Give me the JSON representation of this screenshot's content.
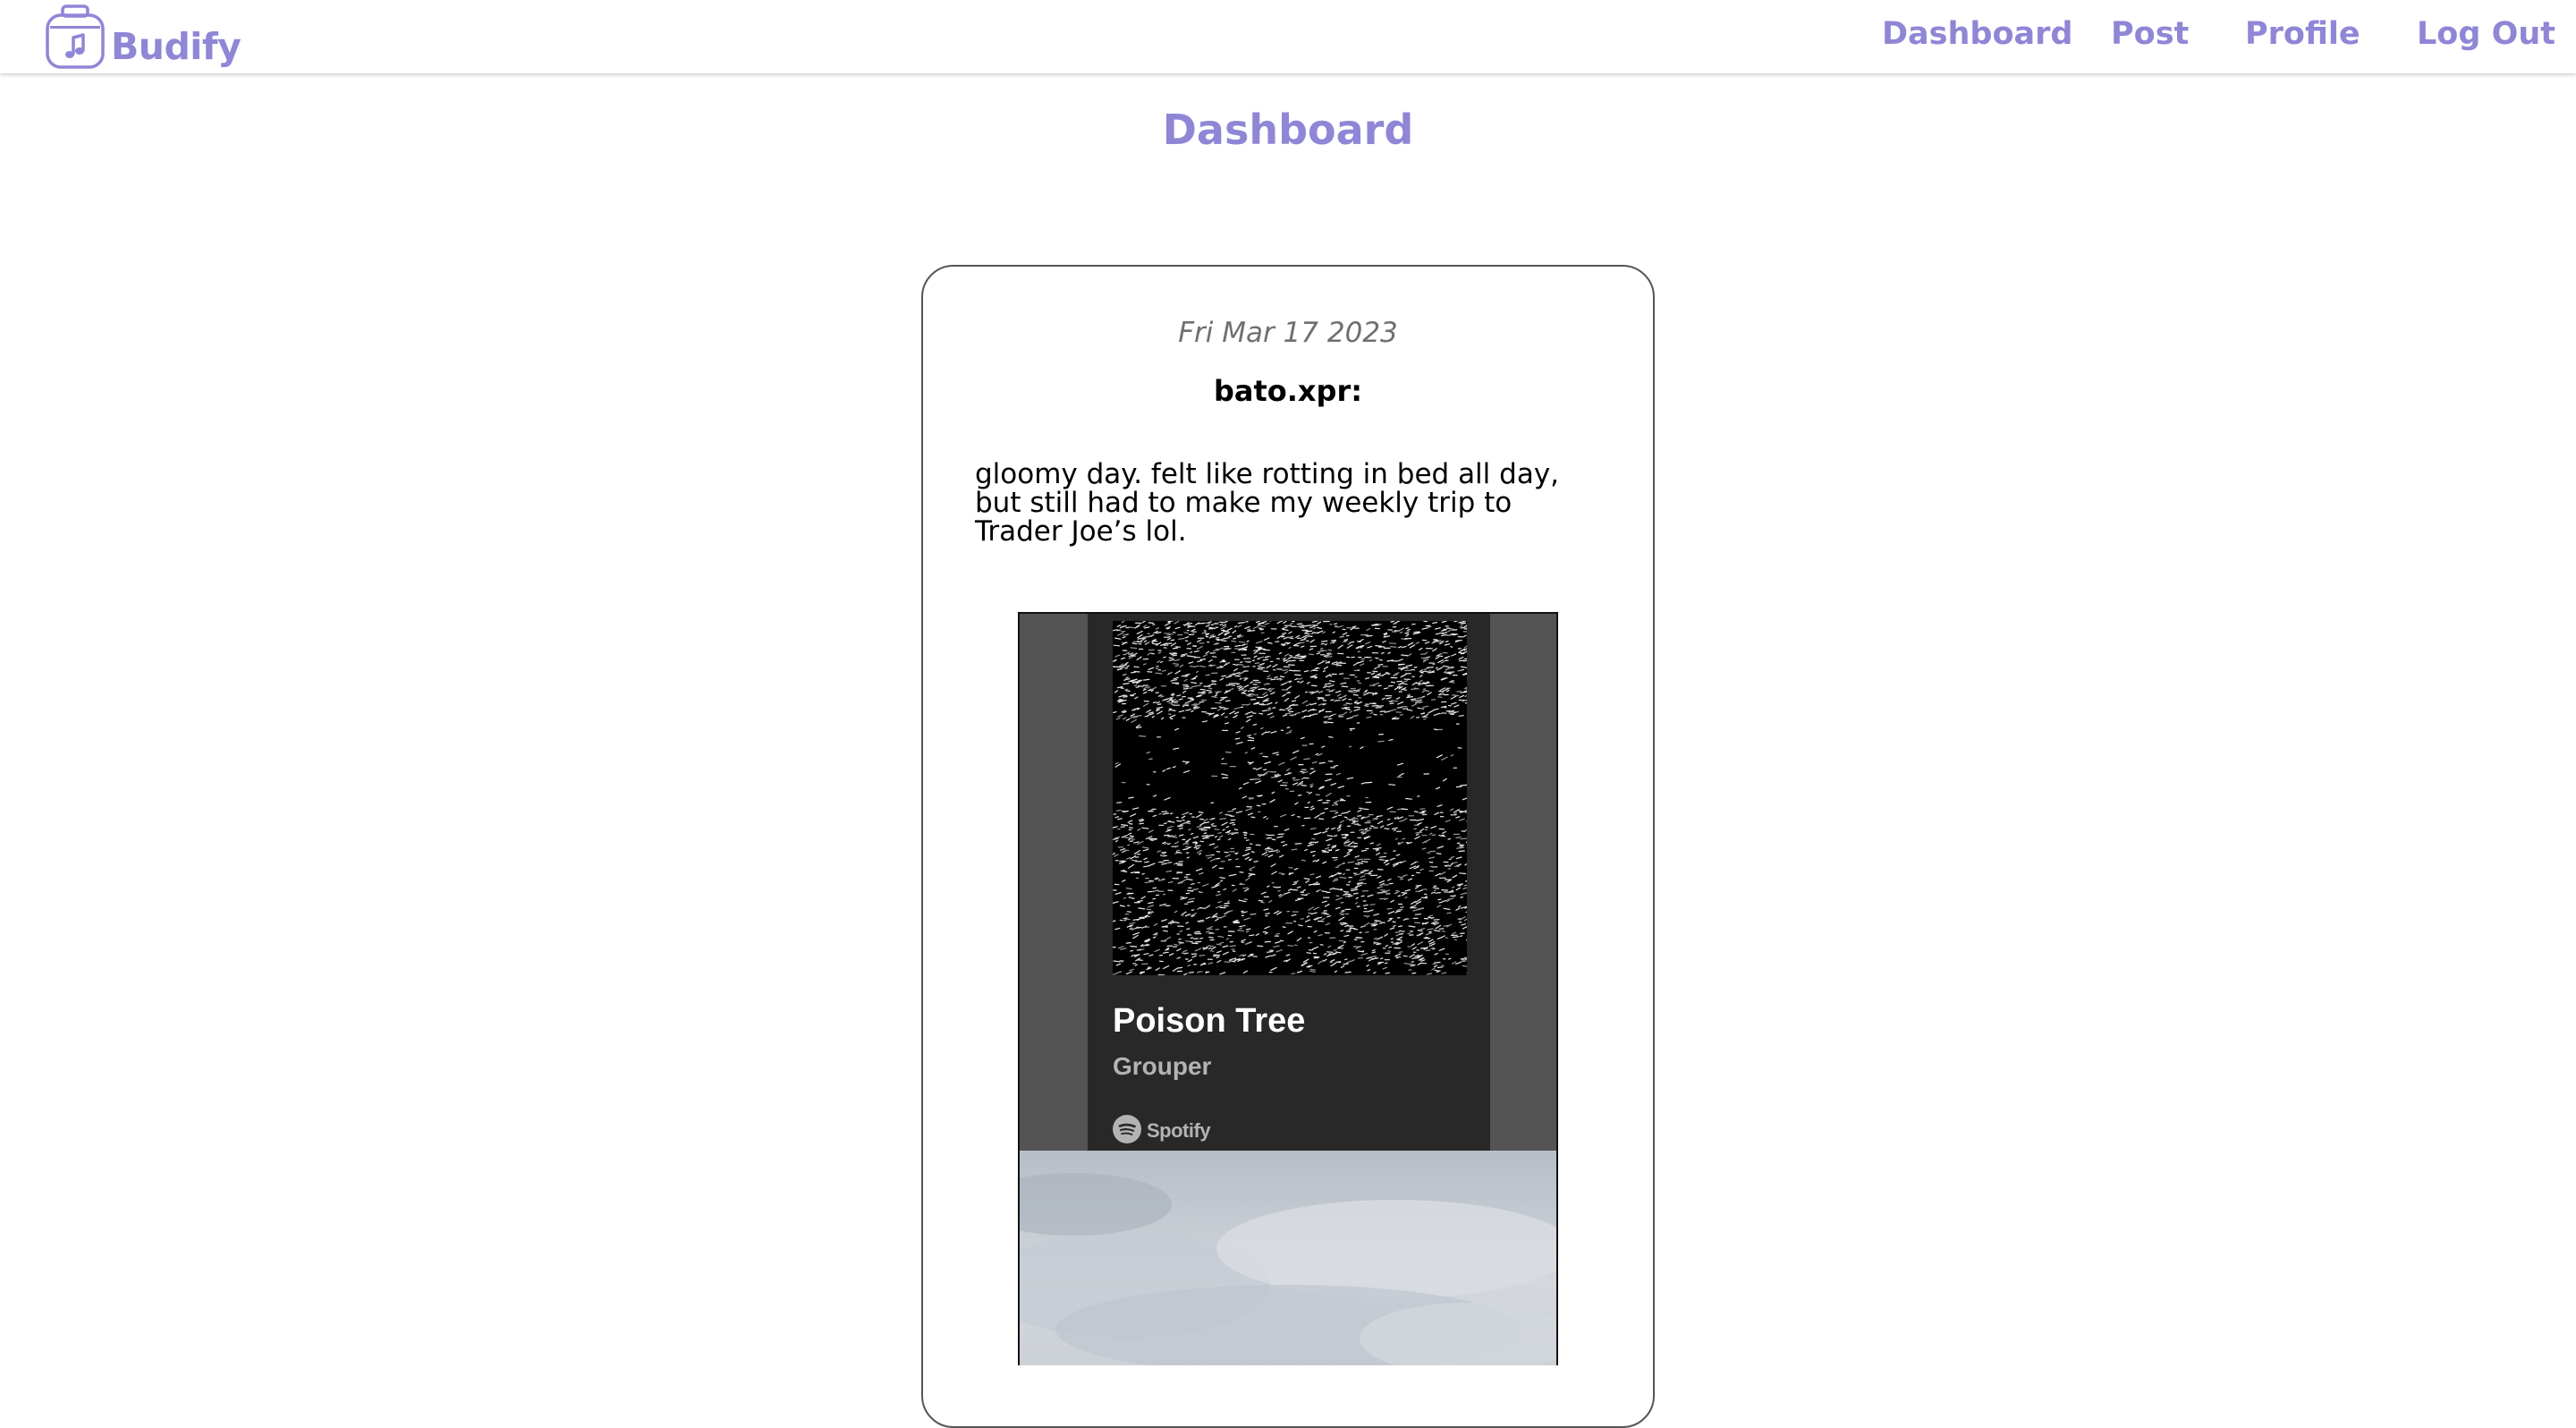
{
  "brand": {
    "name": "Budify",
    "logo_icon": "music-note-jar-icon"
  },
  "nav": {
    "dashboard": "Dashboard",
    "post": "Post",
    "profile": "Profile",
    "logout": "Log Out"
  },
  "page": {
    "title": "Dashboard"
  },
  "post": {
    "date": "Fri Mar 17 2023",
    "username": "bato.xpr:",
    "body": "gloomy day. felt like rotting in bed all day, but still had to make my weekly trip to Trader Joe’s lol.",
    "track": {
      "title": "Poison Tree",
      "artist": "Grouper",
      "service": "Spotify",
      "service_icon": "spotify-icon"
    },
    "photo": "cloudy-sky-photo"
  },
  "colors": {
    "accent": "#8f86d6",
    "embed_bg": "#545454",
    "embed_inner": "#282828"
  }
}
